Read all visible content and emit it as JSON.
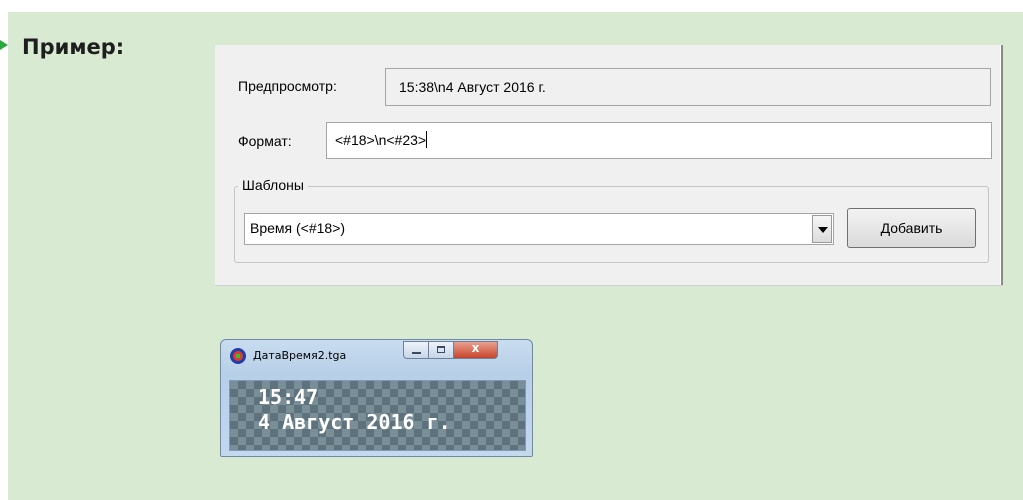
{
  "heading": "Пример:",
  "dialog": {
    "preview_label": "Предпросмотр:",
    "preview_value": "15:38\\n4 Август 2016 г.",
    "format_label": "Формат:",
    "format_value": "<#18>\\n<#23>",
    "templates_group": "Шаблоны",
    "template_selected": "Время (<#18>)",
    "add_button": "Добавить"
  },
  "window": {
    "title": "ДатаВремя2.tga",
    "time_line": "15:47",
    "date_line": "4 Август 2016 г."
  },
  "colors": {
    "panel_bg": "#d9ead3",
    "dialog_bg": "#f0f0f0",
    "accent_arrow": "#29a83b"
  }
}
